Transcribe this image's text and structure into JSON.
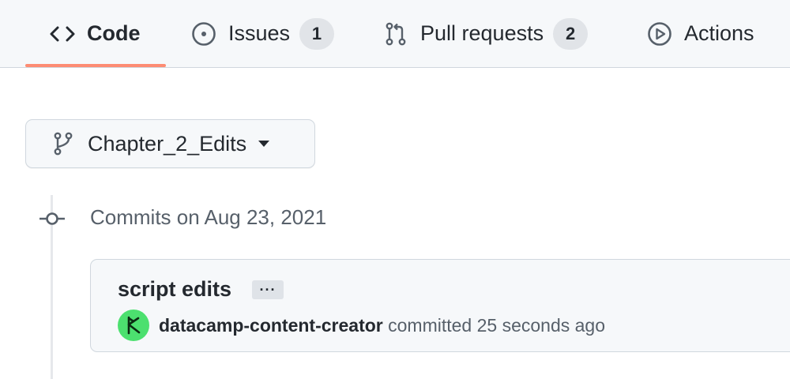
{
  "tabs": [
    {
      "label": "Code",
      "icon": "code-icon",
      "selected": true
    },
    {
      "label": "Issues",
      "icon": "issue-opened-icon",
      "count": "1"
    },
    {
      "label": "Pull requests",
      "icon": "git-pull-request-icon",
      "count": "2"
    },
    {
      "label": "Actions",
      "icon": "play-icon"
    }
  ],
  "branch": {
    "name": "Chapter_2_Edits",
    "icon": "git-branch-icon"
  },
  "timeline": {
    "date_heading": "Commits on Aug 23, 2021",
    "commits": [
      {
        "title": "script edits",
        "ellipsis": "···",
        "author": "datacamp-content-creator",
        "action_text": "committed 25 seconds ago",
        "avatar_color": "#4ce06f"
      }
    ]
  },
  "colors": {
    "tab_underline": "#fd8c73",
    "header_bg": "#f6f8fa",
    "muted_text": "#57606a"
  }
}
